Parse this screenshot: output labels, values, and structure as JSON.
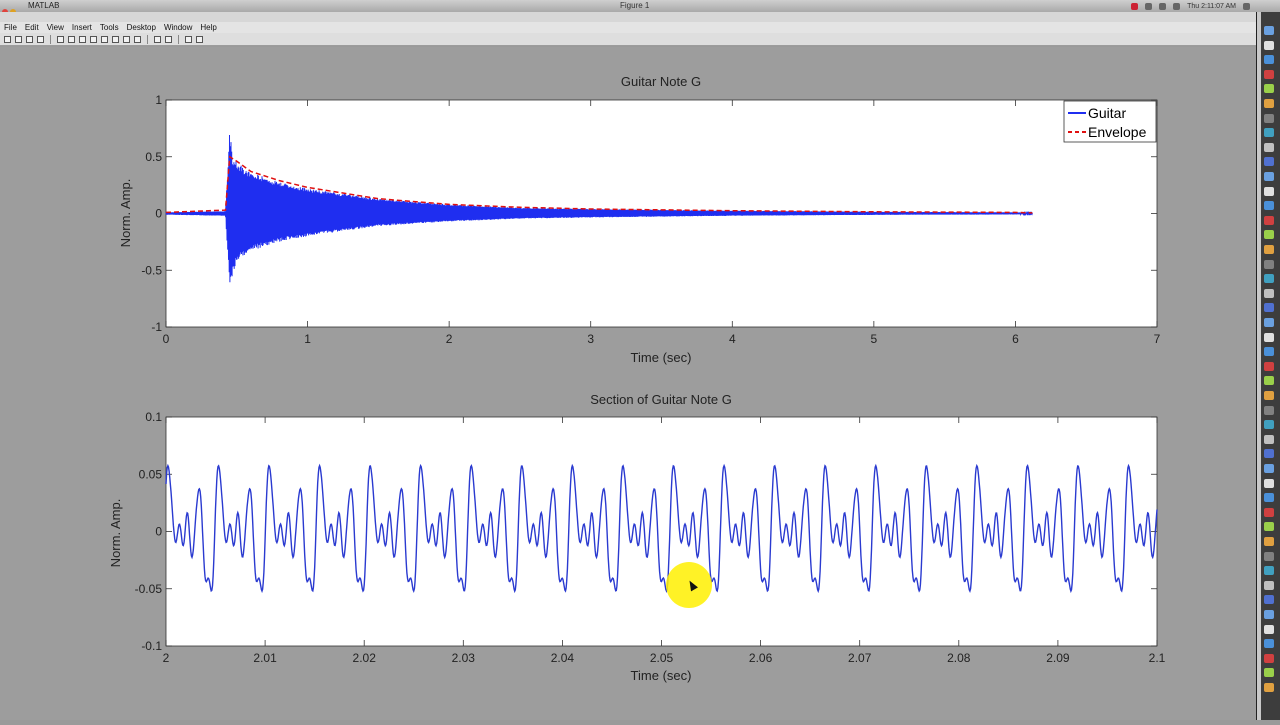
{
  "window": {
    "app_name": "MATLAB",
    "title": "Figure 1",
    "clock": "Thu 2:11:07 AM"
  },
  "menu": [
    "File",
    "Edit",
    "View",
    "Insert",
    "Tools",
    "Desktop",
    "Window",
    "Help"
  ],
  "toolbar_icons": [
    "new-figure-icon",
    "open-icon",
    "save-icon",
    "print-icon",
    "pointer-icon",
    "zoom-in-icon",
    "zoom-out-icon",
    "pan-icon",
    "rotate-icon",
    "data-cursor-icon",
    "brush-icon",
    "link-icon",
    "colorbar-icon",
    "legend-icon",
    "hide-tools-icon",
    "show-tools-icon"
  ],
  "colors": {
    "guitar": "#1f2ef0",
    "envelope": "#e01010",
    "highlight": "#fff000"
  },
  "chart_data": [
    {
      "type": "line",
      "title": "Guitar Note G",
      "xlabel": "Time (sec)",
      "ylabel": "Norm. Amp.",
      "xlim": [
        0,
        7
      ],
      "ylim": [
        -1,
        1
      ],
      "xticks": [
        "0",
        "1",
        "2",
        "3",
        "4",
        "5",
        "6",
        "7"
      ],
      "yticks": [
        "-1",
        "-0.5",
        "0",
        "0.5",
        "1"
      ],
      "legend": {
        "location": "top-right",
        "entries": [
          "Guitar",
          "Envelope"
        ]
      },
      "series": [
        {
          "name": "Guitar",
          "style": "solid",
          "x": [
            0,
            0.42,
            0.45,
            0.47,
            0.5,
            0.6,
            0.8,
            1.0,
            1.5,
            2.0,
            2.5,
            3.0,
            4.0,
            5.0,
            6.0,
            6.12
          ],
          "y_max": [
            0.01,
            0.02,
            0.74,
            0.5,
            0.45,
            0.36,
            0.28,
            0.22,
            0.13,
            0.08,
            0.05,
            0.04,
            0.025,
            0.015,
            0.01,
            0.005
          ],
          "y_min": [
            -0.01,
            -0.02,
            -0.65,
            -0.55,
            -0.42,
            -0.33,
            -0.25,
            -0.2,
            -0.11,
            -0.07,
            -0.045,
            -0.035,
            -0.02,
            -0.012,
            -0.008,
            -0.004
          ]
        },
        {
          "name": "Envelope",
          "style": "dashed",
          "x": [
            0,
            0.42,
            0.45,
            0.5,
            0.6,
            0.8,
            1.0,
            1.5,
            2.0,
            2.5,
            3.0,
            4.0,
            5.0,
            6.0,
            6.12
          ],
          "y": [
            0.01,
            0.03,
            0.5,
            0.46,
            0.37,
            0.29,
            0.23,
            0.13,
            0.08,
            0.055,
            0.04,
            0.025,
            0.015,
            0.01,
            0.005
          ]
        }
      ]
    },
    {
      "type": "line",
      "title": "Section of Guitar Note G",
      "xlabel": "Time (sec)",
      "ylabel": "Norm. Amp.",
      "xlim": [
        2,
        2.1
      ],
      "ylim": [
        -0.1,
        0.1
      ],
      "xticks": [
        "2",
        "2.01",
        "2.02",
        "2.03",
        "2.04",
        "2.05",
        "2.06",
        "2.07",
        "2.08",
        "2.09",
        "2.1"
      ],
      "yticks": [
        "-0.1",
        "-0.05",
        "0",
        "0.05",
        "0.1"
      ],
      "series": [
        {
          "name": "Guitar",
          "style": "solid",
          "fundamental_hz": 196,
          "peak_amp": 0.058,
          "trough_amp": -0.065
        }
      ]
    }
  ]
}
